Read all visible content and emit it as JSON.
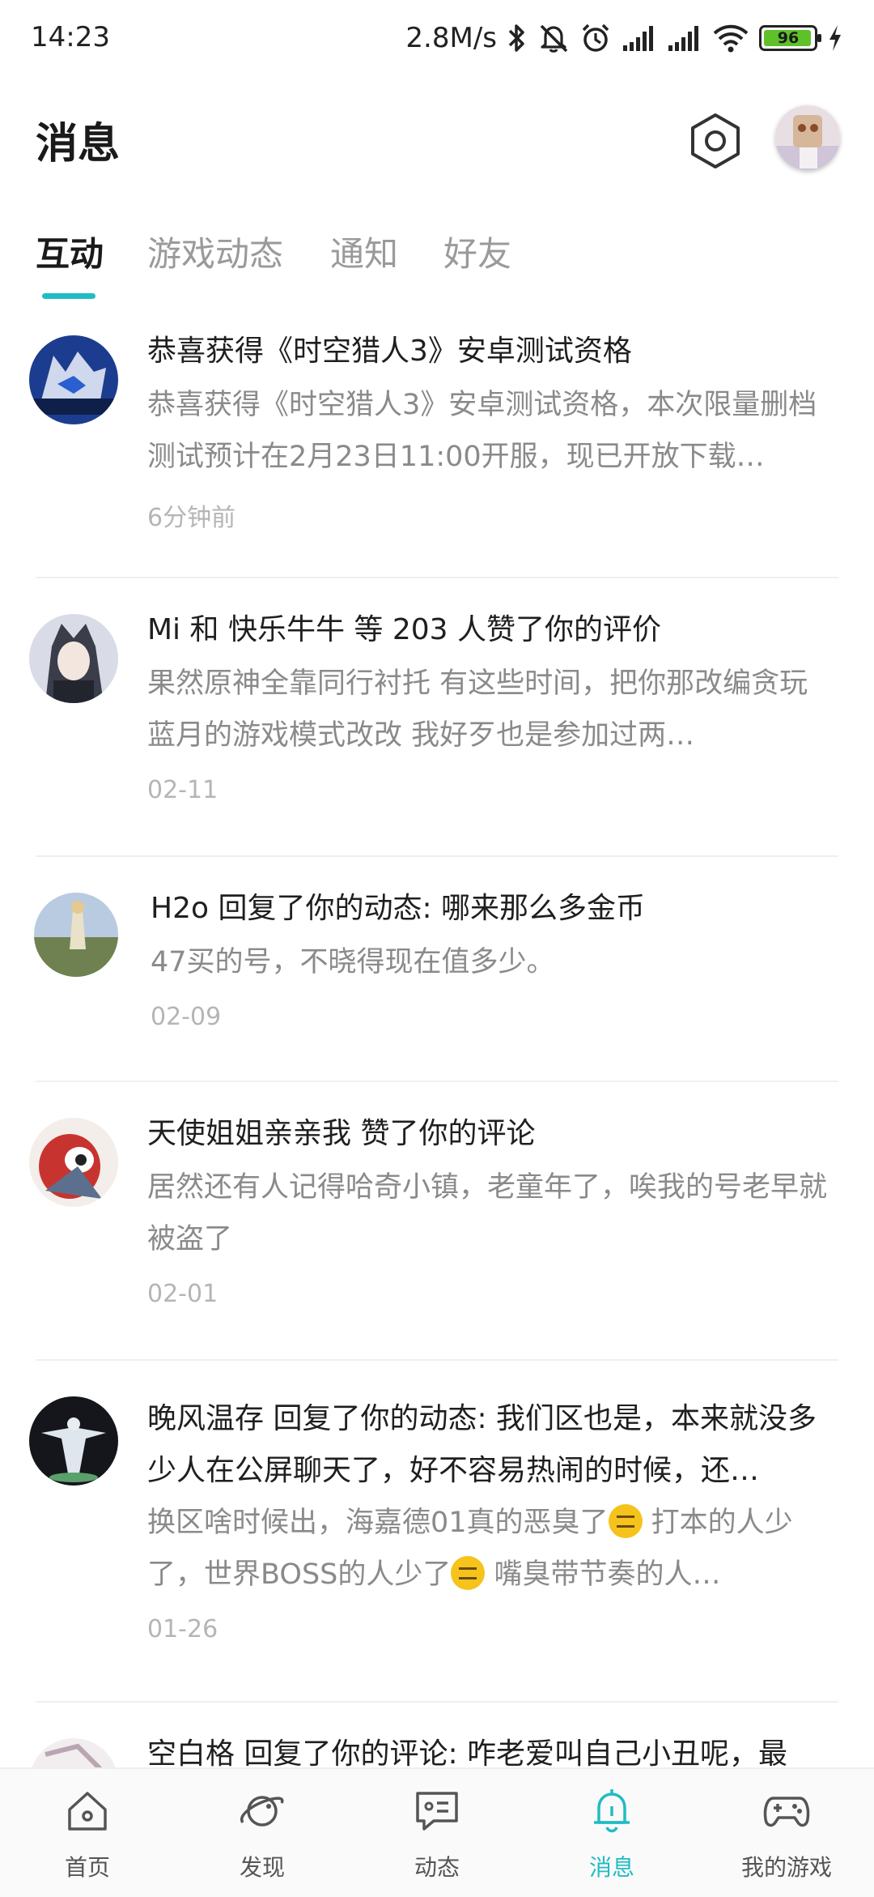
{
  "status_bar": {
    "time": "14:23",
    "network_speed": "2.8M/s",
    "battery_level": "96",
    "battery_fraction": 0.96,
    "icons": [
      "bluetooth-icon",
      "mute-icon",
      "alarm-icon",
      "signal-icon",
      "signal-icon",
      "wifi-icon",
      "battery-icon",
      "charging-icon"
    ]
  },
  "header": {
    "title": "消息",
    "settings_icon": "hexagon-settings-icon"
  },
  "tabs": [
    {
      "label": "互动",
      "active": true
    },
    {
      "label": "游戏动态",
      "active": false
    },
    {
      "label": "通知",
      "active": false
    },
    {
      "label": "好友",
      "active": false
    }
  ],
  "messages": [
    {
      "title": "恭喜获得《时空猎人3》安卓测试资格",
      "text": "恭喜获得《时空猎人3》安卓测试资格，本次限量删档测试预计在2月23日11:00开服，现已开放下载…",
      "time": "6分钟前"
    },
    {
      "title": "Mi 和 快乐牛牛 等 203 人赞了你的评价",
      "text": "果然原神全靠同行衬托 有这些时间，把你那改编贪玩蓝月的游戏模式改改 我好歹也是参加过两…",
      "time": "02-11"
    },
    {
      "title": "H2o 回复了你的动态: 哪来那么多金币",
      "text": "47买的号，不晓得现在值多少。",
      "time": "02-09"
    },
    {
      "title": "天使姐姐亲亲我 赞了你的评论",
      "text": "居然还有人记得哈奇小镇，老童年了，唉我的号老早就被盗了",
      "time": "02-01"
    },
    {
      "title": "晚风温存 回复了你的动态: 我们区也是，本来就没多少人在公屏聊天了，好不容易热闹的时候，还…",
      "text_part1": "换区啥时候出，海嘉德01真的恶臭了",
      "text_part2": " 打本的人少了，世界BOSS的人少了",
      "text_part3": " 嘴臭带节奏的人…",
      "time": "01-26"
    },
    {
      "title": "空白格 回复了你的评论: 咋老爱叫自己小丑呢，最"
    }
  ],
  "bottom_nav": [
    {
      "label": "首页",
      "icon": "home-icon",
      "active": false
    },
    {
      "label": "发现",
      "icon": "planet-icon",
      "active": false
    },
    {
      "label": "动态",
      "icon": "chat-icon",
      "active": false
    },
    {
      "label": "消息",
      "icon": "bell-icon",
      "active": true
    },
    {
      "label": "我的游戏",
      "icon": "gamepad-icon",
      "active": false
    }
  ],
  "colors": {
    "accent": "#1fbcc2",
    "title_text": "#1f1f1f",
    "body_text": "#8a8a8a",
    "time_text": "#b5b5b5"
  }
}
